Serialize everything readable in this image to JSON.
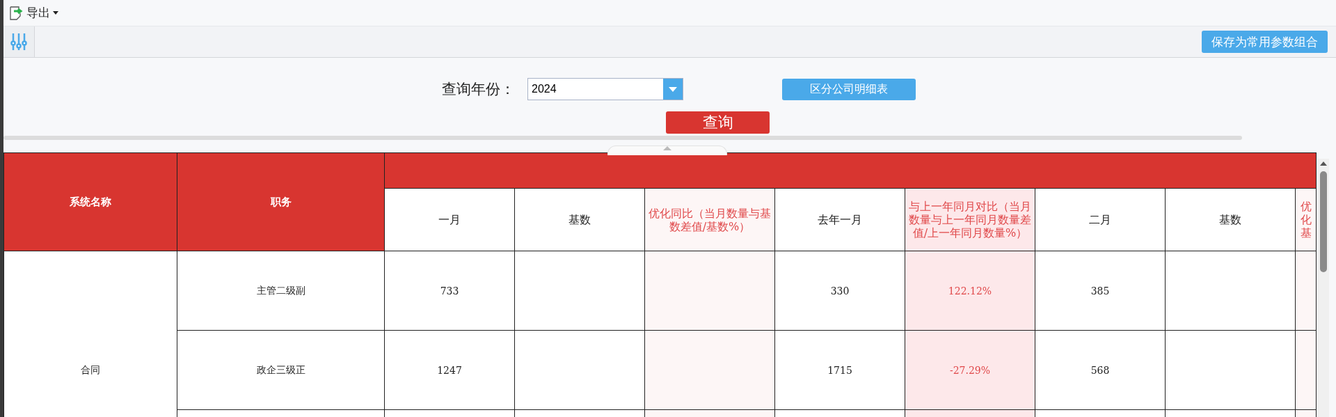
{
  "toolbar": {
    "export_label": "导出",
    "save_button": "保存为常用参数组合"
  },
  "query": {
    "label": "查询年份：",
    "year": "2024",
    "detail_button": "区分公司明细表",
    "submit": "查询"
  },
  "table": {
    "columns": [
      "系统名称",
      "职务"
    ],
    "month_columns": [
      {
        "label": "一月",
        "kind": "value"
      },
      {
        "label": "基数",
        "kind": "value"
      },
      {
        "label": "优化同比（当月数量与基数差值/基数%）",
        "kind": "optimize"
      },
      {
        "label": "去年一月",
        "kind": "value"
      },
      {
        "label": "与上一年同月对比（当月数量与上一年同月数量差值/上一年同月数量%）",
        "kind": "yoy"
      },
      {
        "label": "二月",
        "kind": "value"
      },
      {
        "label": "基数",
        "kind": "value"
      },
      {
        "label": "优化基",
        "kind": "cut"
      }
    ],
    "groups": [
      {
        "name": "合同",
        "rows": [
          {
            "title": "主管二级副",
            "cells": [
              {
                "kind": "text",
                "text": "733"
              },
              {
                "kind": "blank"
              },
              {
                "kind": "blank"
              },
              {
                "kind": "text",
                "text": "330"
              },
              {
                "kind": "text",
                "text": "122.12%"
              },
              {
                "kind": "text",
                "text": "385"
              },
              {
                "kind": "blank"
              },
              {
                "kind": "blank"
              }
            ]
          },
          {
            "title": "政企三级正",
            "cells": [
              {
                "kind": "text",
                "text": "1247"
              },
              {
                "kind": "blank"
              },
              {
                "kind": "blank"
              },
              {
                "kind": "text",
                "text": "1715"
              },
              {
                "kind": "text",
                "text": "-27.29%"
              },
              {
                "kind": "text",
                "text": "568"
              },
              {
                "kind": "blank"
              },
              {
                "kind": "blank"
              }
            ]
          }
        ]
      }
    ]
  }
}
